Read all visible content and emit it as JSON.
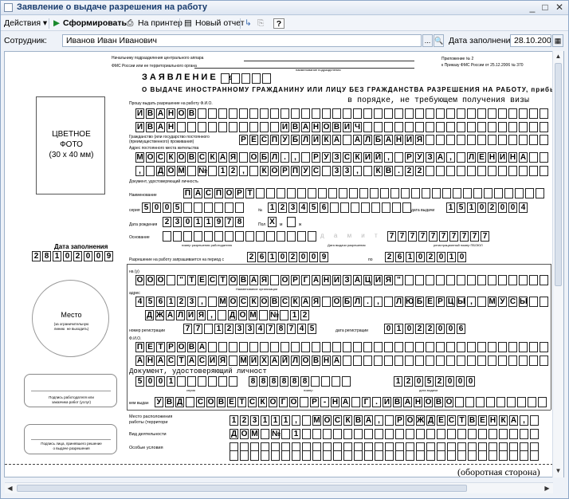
{
  "window": {
    "title": "Заявление о выдаче разрешения на работу"
  },
  "toolbar": {
    "actions": "Действия",
    "generate": "Сформировать",
    "printer": "На принтер",
    "new_report": "Новый отчет",
    "help": "?"
  },
  "header": {
    "employee_label": "Сотрудник:",
    "employee_value": "Иванов Иван Иванович",
    "date_label": "Дата заполнения:",
    "date_value": "28.10.2009"
  },
  "doc": {
    "addr_line1": "Начальнику подразделения центрального аппара",
    "addr_line2": "ФМС России или ее территориального органа",
    "dept_label": "наименование подразделения",
    "appendix1": "Приложение № 2",
    "appendix2": "к Приказу ФМС России от 25.12.2006 № 370",
    "title": "ЗАЯВЛЕНИЕ №",
    "subtitle": "О ВЫДАЧЕ ИНОСТРАННОМУ ГРАЖДАНИНУ ИЛИ ЛИЦУ БЕЗ ГРАЖДАНСТВА РАЗРЕШЕНИЯ НА РАБОТУ, прибывающему в Р",
    "photo_label": "ЦВЕТНОЕ\nФОТО\n(30 х 40 мм)",
    "ask_label": "Прошу выдать разрешение на работу Ф.И.О.",
    "no_visa": "в порядке, не требующем получения визы",
    "surname": "ИВАНОВ",
    "name": "ИВАН",
    "patronymic": "ИВАНОВИЧ",
    "citizenship_label": "Гражданство (или государство постоянного (преимущественного) проживания)",
    "citizenship": "РЕСПУБЛИКА АЛБАНИЯ",
    "address_label": "Адрес постоянного места жительства",
    "address1": "МОСКОВСКАЯ ОБЛ., РУЗСКИЙ, РУЗА, ЛЕНИНА",
    "address2": ", ДОМ № 12, КОРПУС 33, КВ.22",
    "iddoc_label": "Документ, удостоверяющий личность",
    "doc_name_label": "Наименование",
    "doc_name": "ПАСПОРТ",
    "series_label": "серия",
    "series": "5005",
    "num_label": "№",
    "number": "123456",
    "issue_label": "дата выдачи",
    "issue_date": "15102004",
    "dob_label": "Дата рождения",
    "dob": "23011978",
    "sex_label": "Пол",
    "sex_m_mark": "X",
    "sex_m": "м",
    "sex_f": "ж",
    "basis_label": "Основание",
    "basis_faint": "д а м и т т г",
    "basis_num": "7777777777",
    "perm_num_label": "номер разрешения работодателю",
    "perm_date_label": "Дата выдачи разрешения",
    "pboyul_label": "регистрационный номер ПБОЮЛ",
    "period_label": "Разрешение на работу запрашивается на период с",
    "period_from": "26102009",
    "period_to_label": "по",
    "period_to": "26102010",
    "fill_date_label": "Дата заполнения",
    "fill_date": "28102009",
    "in_label": "на (у)",
    "org_name_label": "Наименование организации",
    "org_name": "ООО \"ТЕСТОВАЯ ОРГАНИЗАЦИЯ\"",
    "org_addr_label": "адрес",
    "org_addr1": "456123, МОСКОВСКАЯ ОБЛ., ЛЮБЕРЦЫ, МУСЫ",
    "org_addr2": "ДЖАЛИЯ, ДОМ № 12",
    "reg_label": "номер регистрации",
    "reg_num": "77 1233478745",
    "reg_date_label": "дата регистрации",
    "reg_date": "01022006",
    "fio_label": "Ф.И.О.",
    "fio1": "ПЕТРОВА",
    "fio2": "АНАСТАСИЯ МИХАЙЛОВНА",
    "fio_doc": "Документ, удостоверяющий личност",
    "place_label": "Место",
    "place_sub": "(за ограничительную\nлинию  не выходить)",
    "emp_series": "5001",
    "emp_num": "888888",
    "emp_date": "12052000",
    "ser_label": "серия",
    "n_label": "номер",
    "d_label": "дата выдачи",
    "issued_by_label": "кем выдан",
    "issued_by": "УВД СОВЕТСКОГО Р-НА Г.ИВАНОВО",
    "sign1": "Подпись работодателя или\nзаказчика работ (услуг)",
    "sign2": "Подпись лица, принявшего решение\nо выдаче разрешения",
    "loc_label": "Место расположения\nработы (территори",
    "loc": "123111, МОСКВА, РОЖДЕСТВЕНКА,",
    "activity_label": "Вид деятельности",
    "activity": "ДОМ № 1",
    "special_label": "Особые условия",
    "back_side": "(оборотная сторона)"
  }
}
